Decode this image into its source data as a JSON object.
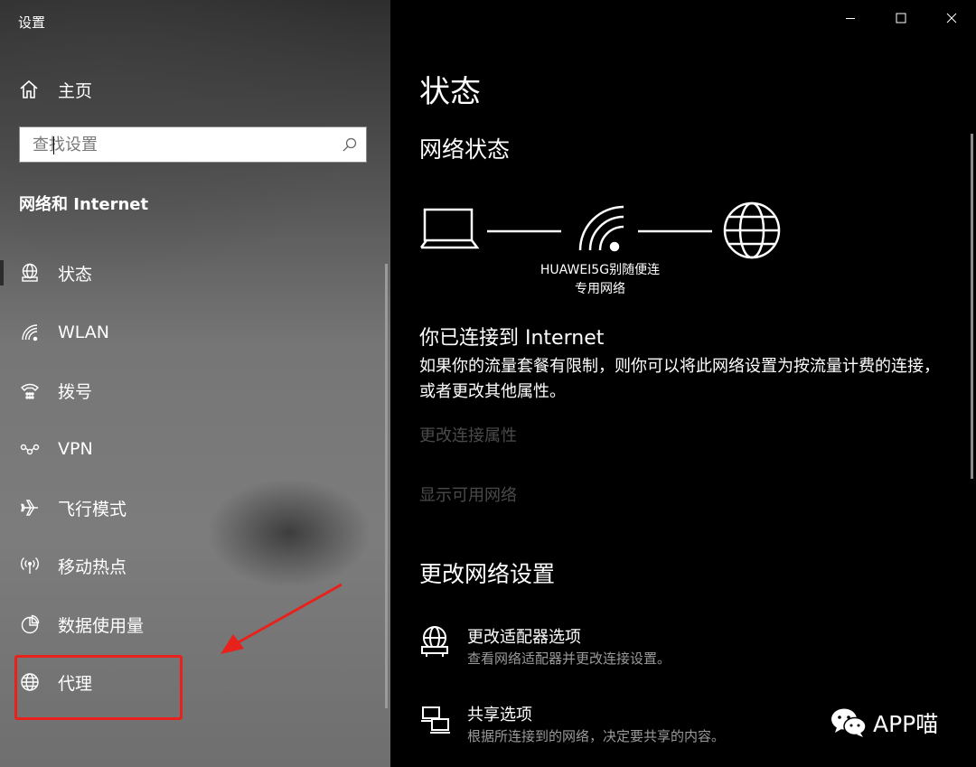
{
  "window": {
    "title": "设置"
  },
  "sidebar": {
    "home_label": "主页",
    "search_placeholder": "查找设置",
    "section_title": "网络和 Internet",
    "items": [
      {
        "label": "状态",
        "icon": "status-globe-icon"
      },
      {
        "label": "WLAN",
        "icon": "wifi-icon"
      },
      {
        "label": "拨号",
        "icon": "dialup-icon"
      },
      {
        "label": "VPN",
        "icon": "vpn-icon"
      },
      {
        "label": "飞行模式",
        "icon": "airplane-icon"
      },
      {
        "label": "移动热点",
        "icon": "hotspot-icon"
      },
      {
        "label": "数据使用量",
        "icon": "data-usage-icon"
      },
      {
        "label": "代理",
        "icon": "proxy-globe-icon"
      }
    ],
    "active_item": "状态",
    "annotation": {
      "highlight_color": "#e8211c"
    }
  },
  "main": {
    "page_title": "状态",
    "network_status_heading": "网络状态",
    "network": {
      "name": "HUAWEI5G别随便连",
      "type": "专用网络"
    },
    "connected_title": "你已连接到 Internet",
    "connected_desc": "如果你的流量套餐有限制，则你可以将此网络设置为按流量计费的连接，或者更改其他属性。",
    "links": {
      "change_props": "更改连接属性",
      "show_networks": "显示可用网络"
    },
    "change_heading": "更改网络设置",
    "options": [
      {
        "name": "更改适配器选项",
        "desc": "查看网络适配器并更改连接设置。",
        "icon": "adapter-icon"
      },
      {
        "name": "共享选项",
        "desc": "根据所连接到的网络，决定要共享的内容。",
        "icon": "sharing-icon"
      }
    ]
  },
  "watermark": {
    "text": "APP喵"
  },
  "colors": {
    "sidebar_bg": "#767676",
    "main_bg": "#000000",
    "disabled_link": "#4a4a4a",
    "annotation_red": "#e8211c"
  }
}
